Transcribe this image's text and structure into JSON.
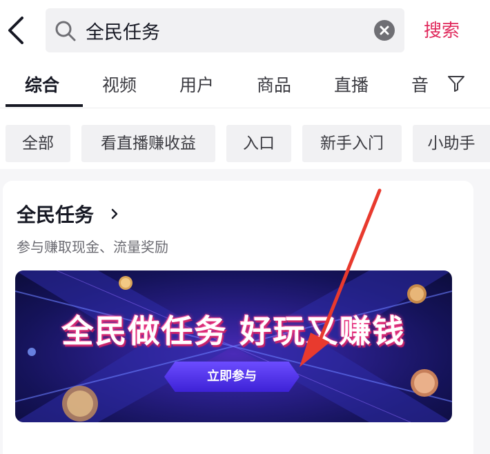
{
  "search": {
    "query": "全民任务",
    "submit_label": "搜索"
  },
  "tabs": [
    {
      "label": "综合",
      "active": true
    },
    {
      "label": "视频"
    },
    {
      "label": "用户"
    },
    {
      "label": "商品"
    },
    {
      "label": "直播"
    },
    {
      "label": "音"
    }
  ],
  "chips": [
    "全部",
    "看直播赚收益",
    "入口",
    "新手入门",
    "小助手"
  ],
  "card": {
    "title": "全民任务",
    "subtitle": "参与赚取现金、流量奖励",
    "banner": {
      "headline": "全民做任务 好玩又赚钱",
      "cta": "立即参与"
    }
  },
  "colors": {
    "accent": "#e0295c",
    "annotation_arrow": "#e83a2e",
    "banner_bg": "#15135a",
    "cta": "#4a2fe6"
  },
  "icons": [
    "back-chevron-icon",
    "search-icon",
    "clear-icon",
    "filter-icon",
    "chevron-right-icon"
  ]
}
